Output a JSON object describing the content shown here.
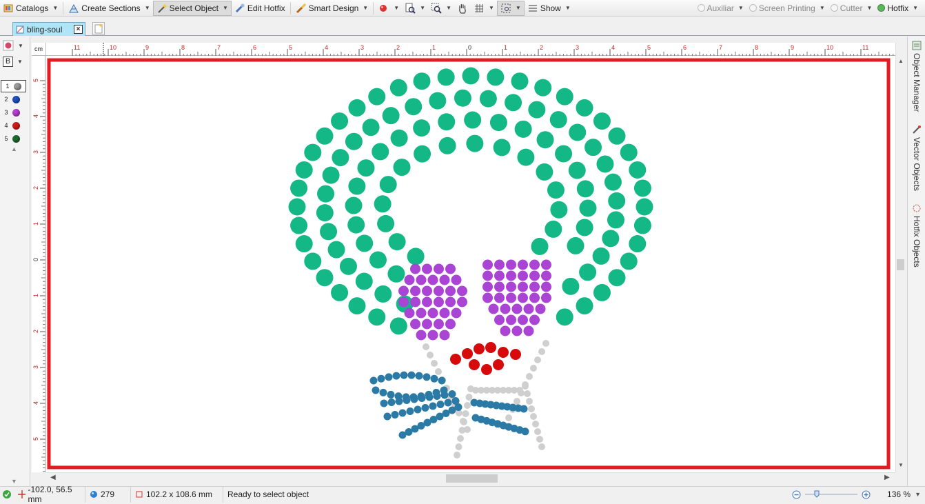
{
  "toolbar": {
    "catalogs": "Catalogs",
    "create_sections": "Create Sections",
    "select_object": "Select Object",
    "edit_hotfix": "Edit Hotfix",
    "smart_design": "Smart Design",
    "show": "Show",
    "auxiliar": "Auxiliar",
    "screen_printing": "Screen Printing",
    "cutter": "Cutter",
    "hotfix": "Hotfix"
  },
  "tabs": {
    "document": "bling-soul"
  },
  "left_panel": {
    "layer_letter": "B",
    "colors": [
      {
        "num": "1",
        "color": "#9a9a9a"
      },
      {
        "num": "2",
        "color": "#1f4fbf"
      },
      {
        "num": "3",
        "color": "#b43fd1"
      },
      {
        "num": "4",
        "color": "#d11a1a"
      },
      {
        "num": "5",
        "color": "#1d6b2e"
      }
    ]
  },
  "ruler": {
    "unit": "cm",
    "h_labels": [
      "11",
      "10",
      "9",
      "8",
      "7",
      "6",
      "5",
      "4",
      "3",
      "2",
      "1",
      "0",
      "1",
      "2",
      "3",
      "4",
      "5",
      "6",
      "7",
      "8",
      "9",
      "10",
      "11"
    ],
    "v_labels": [
      "5",
      "4",
      "3",
      "2",
      "1",
      "0",
      "1",
      "2",
      "3",
      "4",
      "5"
    ]
  },
  "side_panels": {
    "object_manager": "Object Manager",
    "vector_objects": "Vector Objects",
    "hotfix_objects": "Hotfix Objects"
  },
  "status": {
    "coords": "-102.0, 56.5 mm",
    "count": "279",
    "size": "102.2 x 108.6 mm",
    "message": "Ready to select object",
    "zoom": "136 %"
  },
  "colors": {
    "hair": "#13b886",
    "eyes": "#a944d4",
    "lips": "#d60a0a",
    "beard": "#cfcfcf",
    "bow": "#2b7aa6",
    "frame": "#e31b23"
  }
}
